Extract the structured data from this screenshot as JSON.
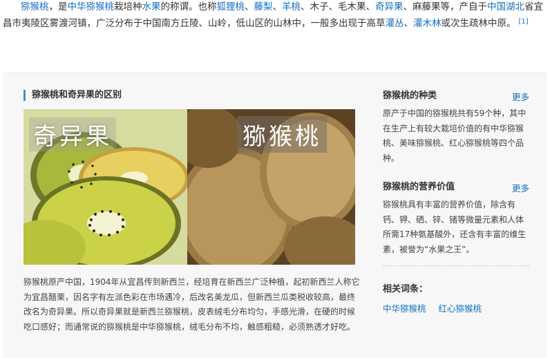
{
  "intro": {
    "segments": [
      {
        "t": "猕猴桃",
        "link": true
      },
      {
        "t": "，是",
        "link": false
      },
      {
        "t": "中华猕猴桃",
        "link": true
      },
      {
        "t": "栽培种",
        "link": false
      },
      {
        "t": "水果",
        "link": true
      },
      {
        "t": "的称谓。也称",
        "link": false
      },
      {
        "t": "狐狸桃",
        "link": true
      },
      {
        "t": "、",
        "link": false
      },
      {
        "t": "藤梨",
        "link": true
      },
      {
        "t": "、",
        "link": false
      },
      {
        "t": "羊桃",
        "link": true
      },
      {
        "t": "、木子、毛木果、",
        "link": false
      },
      {
        "t": "奇异果",
        "link": true
      },
      {
        "t": "、麻藤果等，产自于",
        "link": false
      },
      {
        "t": "中国湖北",
        "link": true
      },
      {
        "t": "省宜昌市夷陵区雾渡河镇，广泛分布于中国南方丘陵、山岭，低山区的山林中，一般多出现于高草",
        "link": false
      },
      {
        "t": "灌丛",
        "link": true
      },
      {
        "t": "、",
        "link": false
      },
      {
        "t": "灌木林",
        "link": true
      },
      {
        "t": "或次生疏林中原。",
        "link": false
      }
    ],
    "ref": "[1]"
  },
  "section": {
    "title": "猕猴桃和奇异果的区别",
    "caption_left": "奇异果",
    "caption_right": "猕猴桃",
    "description": "猕猴桃原产中国，1904年从宜昌传到新西兰，经培育在新西兰广泛种植，起初新西兰人称它为宜昌醋栗，因名字有左派色彩在市场遇冷，后改名美龙瓜，但新西兰瓜类税收较高，最终改名为奇异果。所以奇异果就是新西兰猕猴桃，皮表绒毛分布均匀，手感光滑，在硬的时候吃口感好；而通常说的猕猴桃是中华猕猴桃，绒毛分布不均，触感粗糙，必须熟透才好吃。"
  },
  "sidebar": {
    "block1": {
      "title": "猕猴桃的种类",
      "more": "更多",
      "text": "原产于中国的猕猴桃共有59个种，其中在生产上有较大栽培价值的有中华猕猴桃、美味猕猴桃、红心猕猴桃等四个品种。"
    },
    "block2": {
      "title": "猕猴桃的营养价值",
      "more": "更多",
      "text": "猕猴桃具有丰富的营养价值，除含有钙、钾、硒、锌、锗等微量元素和人体所需17种氨基酸外，还含有丰富的维生素，被誉为“水果之王”。"
    },
    "related_title": "相关词条：",
    "related": [
      "中华猕猴桃",
      "红心猕猴桃"
    ]
  },
  "colors": {
    "link": "#136ec2",
    "accent_bar": "#4b88cc",
    "panel_bg": "#f7f7f7"
  }
}
